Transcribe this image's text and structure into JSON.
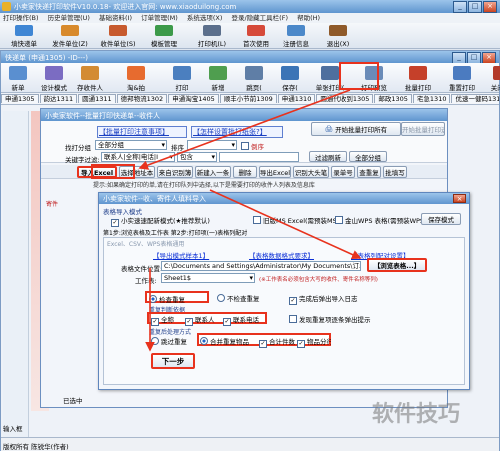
{
  "main_window": {
    "title": "小卖家快递打印软件V10.0.18- 欢迎进入官网: www.xiaoduilong.com",
    "menu": [
      "打印操作(B)",
      "历史单管理(U)",
      "基础资料(I)",
      "订单管理(M)",
      "系统选项(X)",
      "登录/隐藏工具栏(F)",
      "帮助(H)"
    ],
    "toolbar": [
      {
        "label": "填快递单",
        "icon": "fill-waybill-icon",
        "color": "#3f86d4"
      },
      {
        "label": "发件单位(Z)",
        "icon": "sender-icon",
        "color": "#d88a2c"
      },
      {
        "label": "收件单位(S)",
        "icon": "receiver-icon",
        "color": "#c75a2e"
      },
      {
        "label": "模板管理",
        "icon": "template-icon",
        "color": "#3c9a4a"
      },
      {
        "label": "打印机(L)",
        "icon": "printer-icon",
        "color": "#5b6f8c"
      },
      {
        "label": "首次使用",
        "icon": "first-use-icon",
        "color": "#d64a3a"
      },
      {
        "label": "注册信息",
        "icon": "register-icon",
        "color": "#4b88c9"
      },
      {
        "label": "退出(X)",
        "icon": "exit-icon",
        "color": "#8f5a2a"
      }
    ]
  },
  "quick_window": {
    "title": "快递单 (申通1305) -ID---)",
    "toolbar": [
      {
        "label": "新单",
        "icon": "new-icon"
      },
      {
        "label": "设计模式",
        "icon": "design-icon"
      },
      {
        "label": "存收件人",
        "icon": "save-receiver-icon"
      },
      {
        "label": "淘&拍",
        "icon": "taobao-icon"
      },
      {
        "label": "打印",
        "icon": "print-icon"
      },
      {
        "label": "新增",
        "icon": "add-icon"
      },
      {
        "label": "跳页(",
        "icon": "jump-icon"
      },
      {
        "label": "保存(",
        "icon": "save-icon"
      },
      {
        "label": "单张打印(",
        "icon": "single-print-icon"
      },
      {
        "label": "打印预览",
        "icon": "print-preview-icon"
      },
      {
        "label": "批量打印",
        "icon": "batch-print-icon"
      },
      {
        "label": "重置打印",
        "icon": "reset-print-icon"
      },
      {
        "label": "关闭(X)",
        "icon": "close-icon"
      }
    ],
    "taobao_sub": "识别淘宝地址",
    "express_tabs": [
      "申通1305",
      "韵达1311",
      "圆通1311",
      "德邦物流1302",
      "申通淘宝1405",
      "顺丰小节前1309",
      "申通1310",
      "圆通代收到1305",
      "邮政1305",
      "宅急1310",
      "优速一健码1310",
      "申通1305"
    ]
  },
  "batch_window": {
    "title": "小卖家软件--批量打印快递单--收件人",
    "banner_left": "【批量打印注意事项】",
    "banner_right": "【怎样设置批打纸张?】",
    "start_print": "开始批量打印所有",
    "start_selected": "开始批量打印选中",
    "group_label": "找打分组",
    "group_value": "全部分组",
    "sort_label": "排序",
    "repeat_label": "倒序",
    "keyword_label": "关键字过滤:",
    "keyword_field1": "联系人|全称|电话|I",
    "keyword_field2": "包含",
    "filter_button": "过滤刷新",
    "all_group_button": "全部分组",
    "tabs": [
      "发件",
      "|<",
      "<",
      "Q",
      "过"
    ],
    "toolbar": [
      "导入Excel",
      "选择地址本",
      "来自识别簿",
      "新建入一条",
      "删除",
      "导出Excel",
      "识别大头笔",
      "录单号",
      "查重复",
      "批填写"
    ],
    "hint": "提示:如果确定打印的单,请在打印队列中选择,以下是需要打印的收件人列表及信息库",
    "left_row": "寄件"
  },
  "import_window": {
    "title": "小卖家软件--收、寄件人填料导入",
    "tab_section": "表格导入模式",
    "opt_excel_quick": "小实速速配新模式(★推荐默认)",
    "opt_excel_office": "旧版MS Excel(需预装MS Office)",
    "opt_wps": "金山WPS 表格(需预装WPS)",
    "save_mode": "保存模式",
    "steps": "第1步:浏览表格及工作表  第2步:打印项(一)表格列配对",
    "sub_header": "Excel、CSV、WPS表格通用",
    "link_export": "【导出模式样本1】",
    "link_format": "【表格数据格式要求】",
    "link_fields": "【表格列配对设置】",
    "file_label": "表格文件位置:",
    "file_value": "C:\\Documents and Settings\\Administrator\\My Documents\\订单列表_2013-1",
    "browse_btn": "【浏览表格...】",
    "sheet_label": "工作表:",
    "sheet_value": "Sheet1$",
    "sheet_hint": "(※工作表名必须包含大写的收件、寄件名称等列)",
    "check_dup": "检查重复",
    "no_check_dup": "不检查重复",
    "complete_after": "完成后弹出导入日志",
    "dup_method_label": "重复判断依据",
    "dup_all": "全称",
    "dup_contact": "联系人",
    "dup_phone": "联系电话",
    "dup_skip": "发现重复项逐条弹出提示",
    "after_dup_label": "重复后处理方式",
    "skip_repeat": "跳过重复",
    "merge_repeat": "合并重复物品",
    "merge_count": "合计件数",
    "merge_items": "物品分行",
    "next_btn": "下一步",
    "cancel_text": "已选中"
  },
  "status_bar": {
    "left": "版权所有 陈锐华(作者)",
    "inputs_label": "输入框"
  },
  "watermark": "软件技巧"
}
